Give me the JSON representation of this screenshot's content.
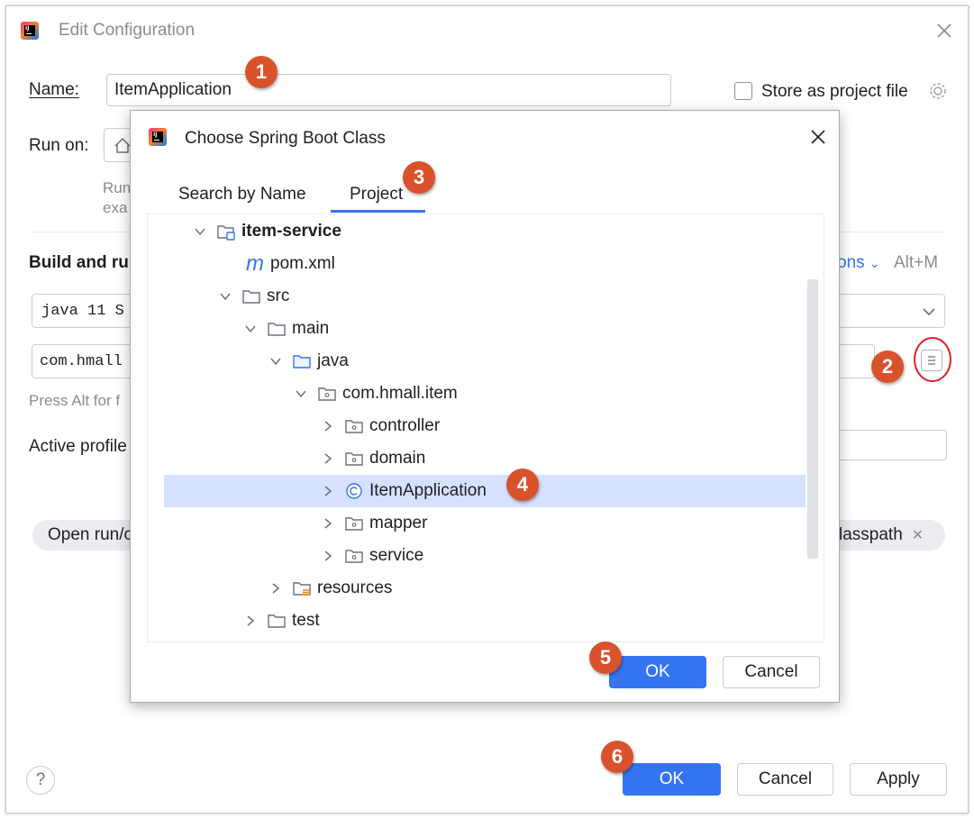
{
  "window": {
    "title": "Edit Configuration",
    "name_label": "Name:",
    "name_value": "ItemApplication",
    "store_label": "Store as project file",
    "run_on_label": "Run on:",
    "run_hint_1": "Run",
    "run_hint_2": "exa",
    "build_label": "Build and ru",
    "modify_options": "ons",
    "modify_shortcut": "Alt+M",
    "jdk_value": "java 11 S",
    "main_class_value": "com.hmall",
    "press_alt": "Press Alt for f",
    "active_profiles": "Active profile",
    "chip_left": "Open run/c",
    "chip_right": "lasspath",
    "help": "?",
    "ok": "OK",
    "cancel": "Cancel",
    "apply": "Apply"
  },
  "dialog": {
    "title": "Choose Spring Boot Class",
    "tabs": [
      {
        "label": "Search by Name",
        "active": false
      },
      {
        "label": "Project",
        "active": true
      }
    ],
    "tree": [
      {
        "label": "item-service",
        "bold": true,
        "icon": "module-folder-icon",
        "expanded": true
      },
      {
        "label": "pom.xml",
        "icon": "maven-icon"
      },
      {
        "label": "src",
        "icon": "folder-icon",
        "expanded": true
      },
      {
        "label": "main",
        "icon": "folder-icon",
        "expanded": true
      },
      {
        "label": "java",
        "icon": "source-folder-icon",
        "expanded": true
      },
      {
        "label": "com.hmall.item",
        "icon": "package-icon",
        "expanded": true
      },
      {
        "label": "controller",
        "icon": "package-icon",
        "expanded": false
      },
      {
        "label": "domain",
        "icon": "package-icon",
        "expanded": false
      },
      {
        "label": "ItemApplication",
        "icon": "spring-boot-class-icon",
        "expanded": false,
        "selected": true
      },
      {
        "label": "mapper",
        "icon": "package-icon",
        "expanded": false
      },
      {
        "label": "service",
        "icon": "package-icon",
        "expanded": false
      },
      {
        "label": "resources",
        "icon": "resources-folder-icon",
        "expanded": false
      },
      {
        "label": "test",
        "icon": "folder-icon",
        "expanded": false
      }
    ],
    "ok": "OK",
    "cancel": "Cancel"
  },
  "badges": [
    "1",
    "2",
    "3",
    "4",
    "5",
    "6"
  ],
  "colors": {
    "accent": "#3574f0",
    "badge": "#d9522c",
    "selection": "#d5e1ff",
    "highlight_ring": "#e0202a"
  }
}
